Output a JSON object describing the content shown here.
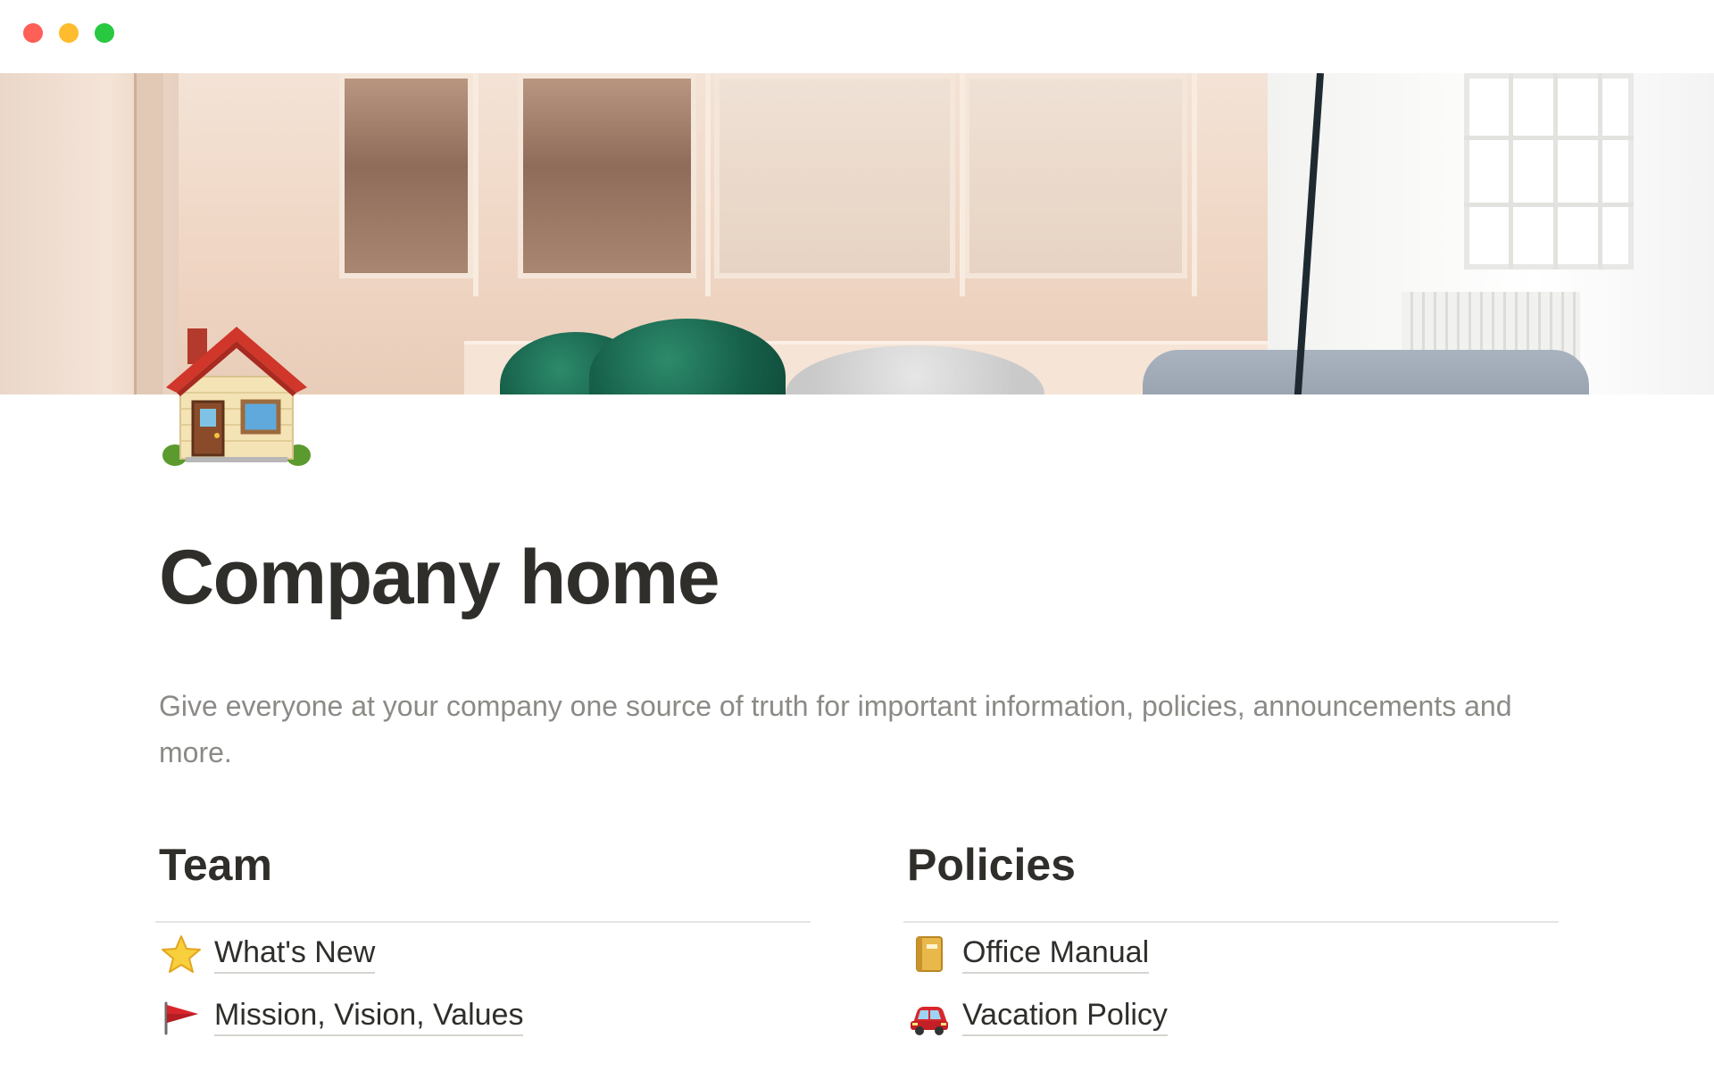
{
  "window": {
    "controls": [
      "close",
      "minimize",
      "maximize"
    ],
    "colors": {
      "close": "#fe5f57",
      "minimize": "#febc2e",
      "maximize": "#28c840"
    }
  },
  "page": {
    "icon": "house-icon",
    "title": "Company home",
    "description": "Give everyone at your company one source of truth for important information, policies, announcements and more."
  },
  "sections": [
    {
      "heading": "Team",
      "items": [
        {
          "icon": "star-icon",
          "label": "What's New"
        },
        {
          "icon": "red-flag-icon",
          "label": "Mission, Vision, Values"
        }
      ]
    },
    {
      "heading": "Policies",
      "items": [
        {
          "icon": "notebook-icon",
          "label": "Office Manual"
        },
        {
          "icon": "car-icon",
          "label": "Vacation Policy"
        }
      ]
    }
  ]
}
